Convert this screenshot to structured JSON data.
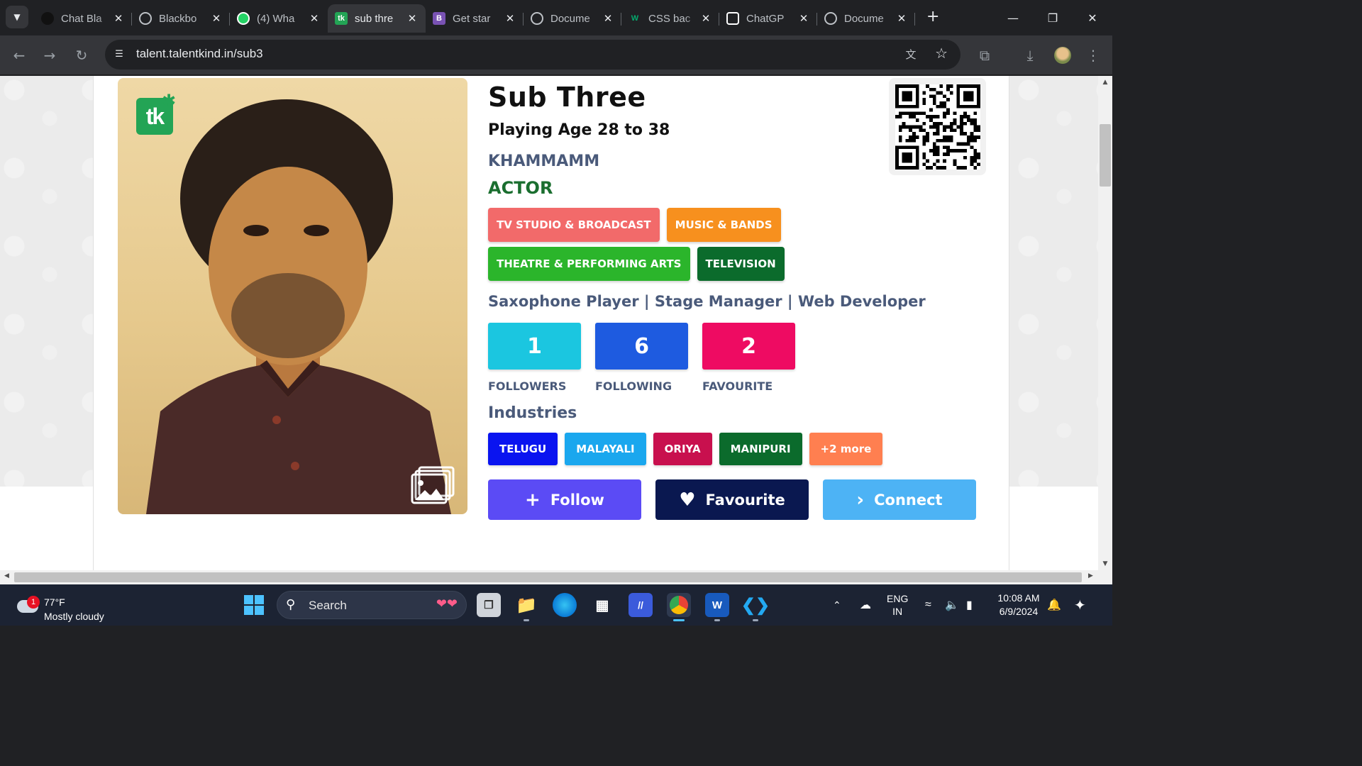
{
  "browser": {
    "tabs": [
      {
        "title": "Chat Bla",
        "icon": "chatbla-icon",
        "color": "#111111"
      },
      {
        "title": "Blackbo",
        "icon": "globe-icon",
        "color": "#5f6368"
      },
      {
        "title": "(4) Wha",
        "icon": "whatsapp-icon",
        "color": "#25d366"
      },
      {
        "title": "sub thre",
        "icon": "talentkind-icon",
        "color": "#23a455"
      },
      {
        "title": "Get star",
        "icon": "bootstrap-icon",
        "color": "#7952b3"
      },
      {
        "title": "Docume",
        "icon": "globe-icon",
        "color": "#5f6368"
      },
      {
        "title": "CSS bac",
        "icon": "w3schools-icon",
        "color": "#04aa6d"
      },
      {
        "title": "ChatGP",
        "icon": "chatgpt-icon",
        "color": "#ffffff"
      },
      {
        "title": "Docume",
        "icon": "globe-icon",
        "color": "#5f6368"
      }
    ],
    "active_tab": 3,
    "url": "talent.talentkind.in/sub3"
  },
  "profile": {
    "name": "Sub Three",
    "playing_age": "Playing Age 28 to 38",
    "city": "KHAMMAMM",
    "role": "ACTOR",
    "categories": [
      {
        "label": "TV STUDIO & BROADCAST",
        "color": "#f26a6a"
      },
      {
        "label": "MUSIC & BANDS",
        "color": "#f7901e"
      },
      {
        "label": "THEATRE & PERFORMING ARTS",
        "color": "#2bb52b"
      },
      {
        "label": "TELEVISION",
        "color": "#0b6b2c"
      }
    ],
    "skills": "Saxophone Player | Stage Manager | Web Developer",
    "stats": [
      {
        "value": "1",
        "label": "FOLLOWERS",
        "color": "#1bc6e0"
      },
      {
        "value": "6",
        "label": "FOLLOWING",
        "color": "#1e5be0"
      },
      {
        "value": "2",
        "label": "FAVOURITE",
        "color": "#ee0b62"
      }
    ],
    "industries_title": "Industries",
    "industries": [
      {
        "label": "TELUGU",
        "color": "#0a14f0"
      },
      {
        "label": "MALAYALI",
        "color": "#1aa7ee"
      },
      {
        "label": "ORIYA",
        "color": "#c8104e"
      },
      {
        "label": "MANIPURI",
        "color": "#0b6b2c"
      },
      {
        "label": "+2 more",
        "color": "#ff7f50"
      }
    ],
    "actions": [
      {
        "label": "Follow",
        "icon": "plus-icon",
        "color": "#5b4bf5"
      },
      {
        "label": "Favourite",
        "icon": "heart-plus-icon",
        "color": "#0a1850"
      },
      {
        "label": "Connect",
        "icon": "chevron-right-icon",
        "color": "#4db3f5"
      }
    ],
    "logo_text": "tk"
  },
  "taskbar": {
    "weather_temp": "77°F",
    "weather_cond": "Mostly cloudy",
    "weather_badge": "1",
    "search_label": "Search",
    "lang_line1": "ENG",
    "lang_line2": "IN",
    "time": "10:08 AM",
    "date": "6/9/2024"
  }
}
